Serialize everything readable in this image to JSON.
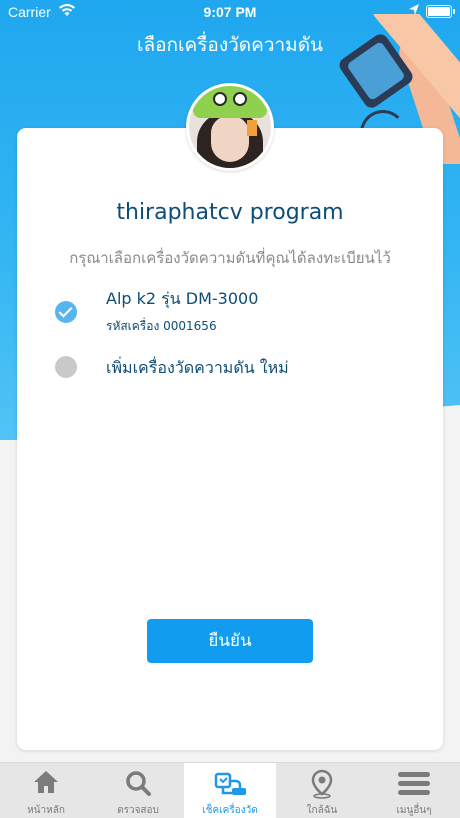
{
  "status_bar": {
    "carrier": "Carrier",
    "time": "9:07 PM"
  },
  "header": {
    "title": "เลือกเครื่องวัดความดัน"
  },
  "card": {
    "program_name": "thiraphatcv program",
    "instruction": "กรุณาเลือกเครื่องวัดความดันที่คุณได้ลงทะเบียนไว้",
    "options": [
      {
        "label": "Alp k2 รุ่น DM-3000",
        "sublabel": "รหัสเครื่อง 0001656",
        "selected": true
      },
      {
        "label": "เพิ่มเครื่องวัดความดัน ใหม่",
        "selected": false
      }
    ],
    "confirm_label": "ยืนยัน"
  },
  "tabbar": {
    "items": [
      {
        "label": "หน้าหลัก",
        "icon": "home-icon",
        "active": false
      },
      {
        "label": "ตรวจสอบ",
        "icon": "search-icon",
        "active": false
      },
      {
        "label": "เช็คเครื่องวัด",
        "icon": "bp-monitor-icon",
        "active": true
      },
      {
        "label": "ใกล้ฉัน",
        "icon": "location-pin-icon",
        "active": false
      },
      {
        "label": "เมนูอื่นๆ",
        "icon": "menu-icon",
        "active": false
      }
    ]
  },
  "colors": {
    "primary": "#129cf0",
    "header": "#1fa7ef",
    "text_dark": "#0d4d78",
    "tab_active": "#1e98e8"
  }
}
